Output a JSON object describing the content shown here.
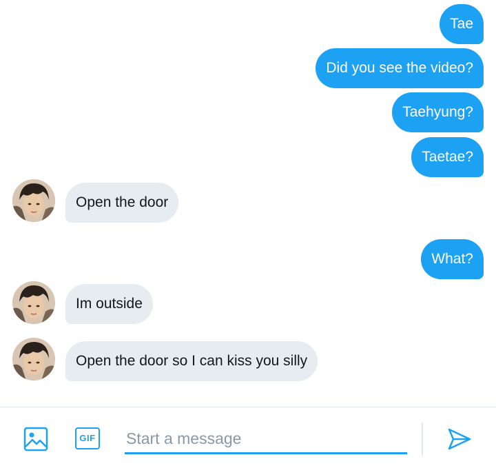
{
  "messages": [
    {
      "sender": "me",
      "text": "Tae"
    },
    {
      "sender": "me",
      "text": "Did you see the video?"
    },
    {
      "sender": "me",
      "text": "Taehyung?"
    },
    {
      "sender": "me",
      "text": "Taetae?"
    },
    {
      "sender": "them",
      "text": "Open the door"
    },
    {
      "sender": "me",
      "text": "What?"
    },
    {
      "sender": "them",
      "text": "Im outside"
    },
    {
      "sender": "them",
      "text": "Open the door so I can kiss you silly"
    }
  ],
  "composer": {
    "placeholder": "Start a message",
    "value": "",
    "gif_label": "GIF",
    "icons": [
      "image-icon",
      "gif-icon",
      "send-icon"
    ]
  },
  "colors": {
    "accent": "#1da1f2",
    "incoming_bubble": "#e6ecf0",
    "outgoing_text": "#ffffff",
    "incoming_text": "#14171a",
    "placeholder": "#8899a6"
  }
}
